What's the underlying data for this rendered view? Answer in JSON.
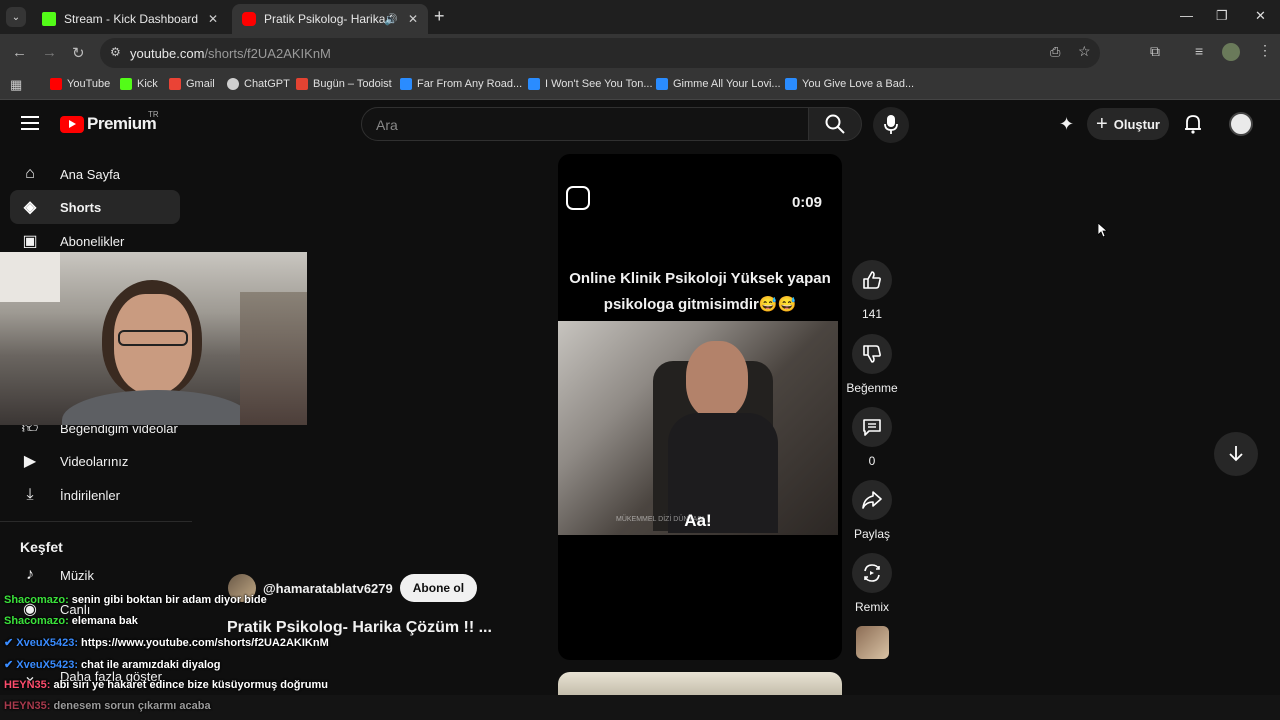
{
  "browser": {
    "tabs": [
      {
        "title": "Stream - Kick Dashboard",
        "favicon_color": "#53fc18",
        "active": false
      },
      {
        "title": "Pratik Psikolog- Harika Çözüm",
        "favicon_color": "#ff0000",
        "active": true
      }
    ],
    "url_host": "youtube.com",
    "url_path": "/shorts/f2UA2AKIKnM",
    "bookmarks": [
      {
        "label": "YouTube",
        "color": "#ff0000"
      },
      {
        "label": "Kick",
        "color": "#53fc18"
      },
      {
        "label": "Gmail",
        "color": "#ea4335"
      },
      {
        "label": "ChatGPT",
        "color": "#d0d0d0"
      },
      {
        "label": "Bugün – Todoist",
        "color": "#e44332"
      },
      {
        "label": "Far From Any Road...",
        "color": "#2a8cff"
      },
      {
        "label": "I Won't See You Ton...",
        "color": "#2a8cff"
      },
      {
        "label": "Gimme All Your Lovi...",
        "color": "#2a8cff"
      },
      {
        "label": "You Give Love a Bad...",
        "color": "#2a8cff"
      }
    ]
  },
  "youtube": {
    "logo_text": "Premium",
    "logo_region": "TR",
    "search_placeholder": "Ara",
    "create_label": "Oluştur",
    "sidebar": {
      "top": [
        {
          "label": "Ana Sayfa",
          "icon": "home-icon"
        },
        {
          "label": "Shorts",
          "icon": "shorts-icon",
          "active": true
        },
        {
          "label": "Abonelikler",
          "icon": "subscriptions-icon"
        }
      ],
      "you": [
        {
          "label": "Beğendiğim videolar",
          "icon": "like-icon"
        },
        {
          "label": "Videolarınız",
          "icon": "your-videos-icon"
        },
        {
          "label": "İndirilenler",
          "icon": "download-icon"
        }
      ],
      "explore_title": "Keşfet",
      "explore": [
        {
          "label": "Müzik",
          "icon": "music-icon"
        },
        {
          "label": "Canlı",
          "icon": "live-icon"
        }
      ],
      "more_label": "Daha fazla göster"
    },
    "short": {
      "duration": "0:09",
      "caption_line1": "Online Klinik Psikoloji Yüksek yapan",
      "caption_line2": "psikologa gitmisimdir😅😅",
      "subtitle": "Aa!",
      "watermark": "MÜKEMMEL DİZİ DÜNYASI",
      "channel": "@hamaratablatv6279",
      "subscribe_label": "Abone ol",
      "title": "Pratik Psikolog- Harika Çözüm !! ..."
    },
    "actions": {
      "like_count": "141",
      "dislike_label": "Beğenme",
      "comment_count": "0",
      "share_label": "Paylaş",
      "remix_label": "Remix"
    }
  },
  "chat_overlay": [
    {
      "user": "Shacomazo:",
      "message": "senin gibi boktan bir adam diyor bide",
      "user_color": "#3be23b",
      "verified": false
    },
    {
      "user": "Shacomazo:",
      "message": "elemana bak",
      "user_color": "#3be23b",
      "verified": false
    },
    {
      "user": "XveuX5423:",
      "message": "https://www.youtube.com/shorts/f2UA2AKIKnM",
      "user_color": "#3a8cff",
      "verified": true
    },
    {
      "user": "XveuX5423:",
      "message": "chat ile aramızdaki diyalog",
      "user_color": "#3a8cff",
      "verified": true
    },
    {
      "user": "HEYN35:",
      "message": "abi siri ye hakaret edince bize küsüyormuş doğrumu",
      "user_color": "#ff4d6d",
      "verified": false
    },
    {
      "user": "HEYN35:",
      "message": "denesem sorun çıkarmı acaba",
      "user_color": "#ff4d6d",
      "verified": false
    }
  ]
}
